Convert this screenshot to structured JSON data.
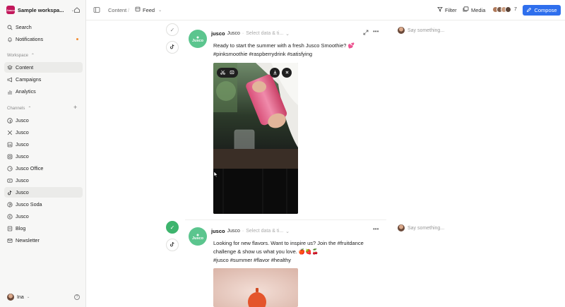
{
  "workspace": {
    "name": "Sample workspa...",
    "logo_text": "Jusco"
  },
  "sidebar": {
    "top_items": [
      {
        "label": "Search",
        "icon": "search-icon"
      },
      {
        "label": "Notifications",
        "icon": "bell-icon"
      }
    ],
    "workspace_label": "Workspace",
    "workspace_items": [
      {
        "label": "Content",
        "icon": "layers-icon",
        "active": true
      },
      {
        "label": "Campaigns",
        "icon": "megaphone-icon"
      },
      {
        "label": "Analytics",
        "icon": "chart-icon"
      }
    ],
    "channels_label": "Channels",
    "channels": [
      {
        "label": "Jusco",
        "icon": "facebook-icon"
      },
      {
        "label": "Jusco",
        "icon": "x-icon"
      },
      {
        "label": "Jusco",
        "icon": "linkedin-icon"
      },
      {
        "label": "Jusco",
        "icon": "instagram-icon"
      },
      {
        "label": "Jusco Office",
        "icon": "google-business-icon"
      },
      {
        "label": "Jusco",
        "icon": "youtube-icon"
      },
      {
        "label": "Jusco",
        "icon": "tiktok-icon",
        "active": true
      },
      {
        "label": "Jusco Soda",
        "icon": "pinterest-icon"
      },
      {
        "label": "Jusco",
        "icon": "threads-icon"
      },
      {
        "label": "Blog",
        "icon": "blog-icon"
      },
      {
        "label": "Newsletter",
        "icon": "mail-icon"
      }
    ],
    "user_name": "Ina"
  },
  "topbar": {
    "breadcrumb_root": "Content",
    "breadcrumb_current": "Feed",
    "filter_label": "Filter",
    "media_label": "Media",
    "collaborators_count": "7",
    "compose_label": "Compose"
  },
  "posts": [
    {
      "account": "jusco",
      "account_sub": "Jusco",
      "schedule_placeholder": "Select data & ti...",
      "line1": "Ready to start the summer with a fresh Jusco Smoothie? 💕",
      "line2": "#pinksmoothie #raspberrydrink #satisfying",
      "line3": "",
      "comment_placeholder": "Say something...",
      "status": "pending"
    },
    {
      "account": "jusco",
      "account_sub": "Jusco",
      "schedule_placeholder": "Select data & ti...",
      "line1": "Looking for new flavors. Want to inspire us? Join the #fruitdance",
      "line2": "challenge & show us what you love. 🍎🍓🍒",
      "line3": "#jusco #summer #flavor #healthy",
      "comment_placeholder": "Say something...",
      "status": "approved"
    }
  ],
  "colors": {
    "accent": "#2f6fed",
    "approved": "#3db46d",
    "brand_avatar": "#5bc58e",
    "workspace_logo": "#c2185b"
  }
}
